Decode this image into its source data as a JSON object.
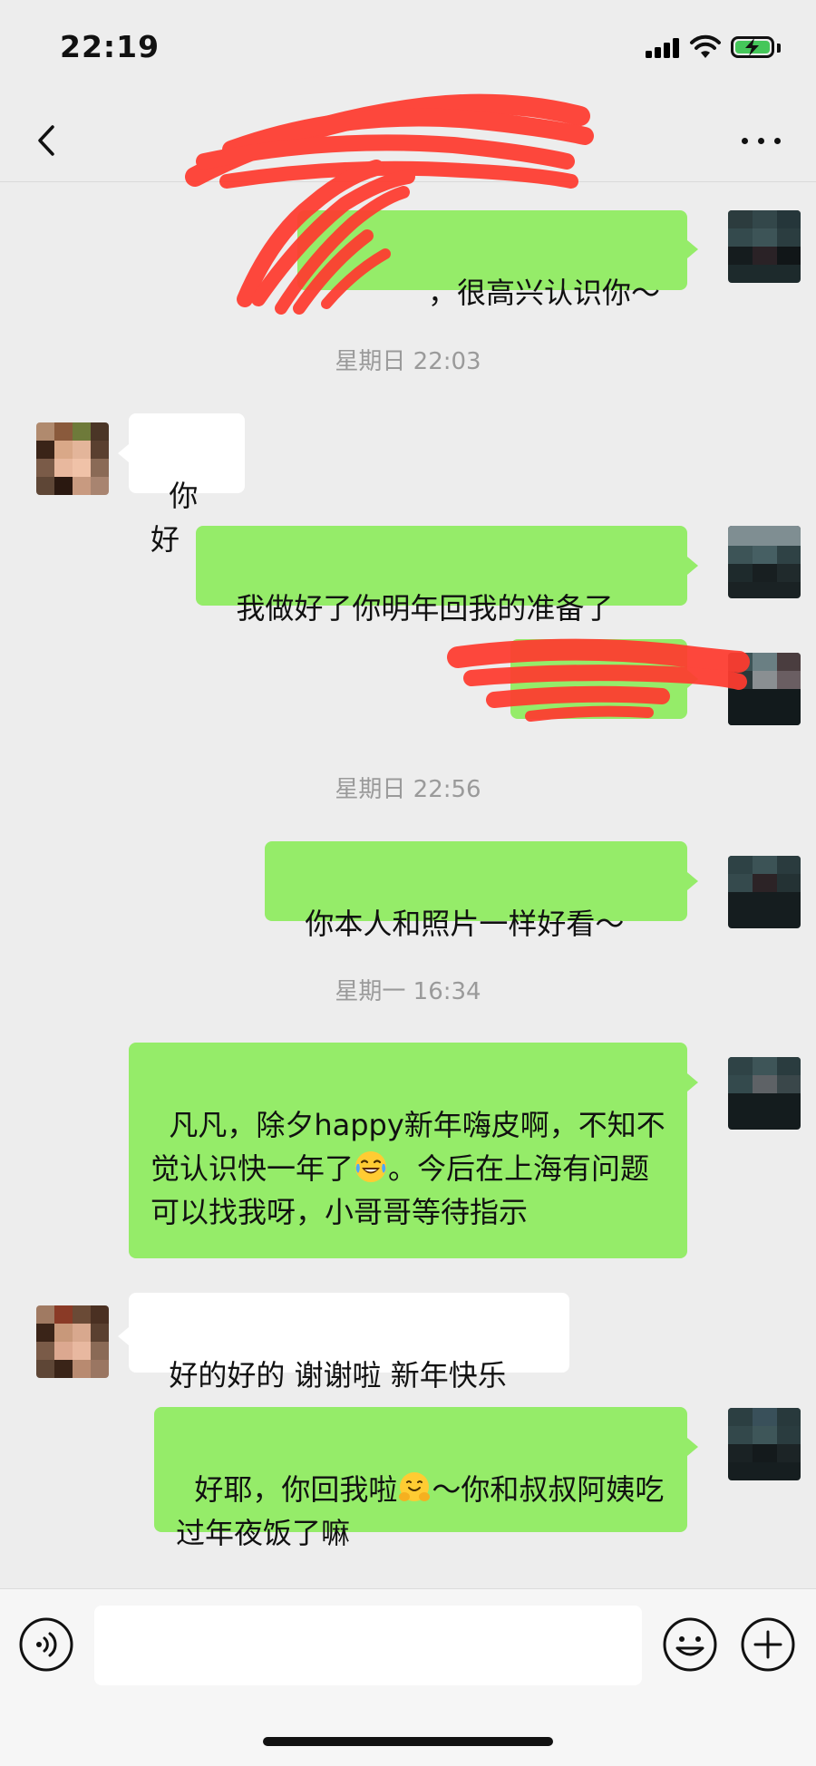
{
  "status_bar": {
    "time": "22:19"
  },
  "nav": {
    "title": ""
  },
  "messages": [
    {
      "side": "out",
      "text": "，很高兴认识你～",
      "partially_redacted": true
    },
    {
      "timestamp": "星期日 22:03"
    },
    {
      "side": "in",
      "text": "你好"
    },
    {
      "side": "out",
      "text": "我做好了你明年回我的准备了"
    },
    {
      "side": "out",
      "text": "",
      "redacted": true
    },
    {
      "timestamp": "星期日 22:56"
    },
    {
      "side": "out",
      "text": "你本人和照片一样好看～"
    },
    {
      "timestamp": "星期一 16:34"
    },
    {
      "side": "out",
      "text_before_emoji": "凡凡，除夕happy新年嗨皮啊，不知不觉认识快一年了",
      "emoji": "face-with-tears-of-joy",
      "text_after_emoji": "。今后在上海有问题可以找我呀，小哥哥等待指示"
    },
    {
      "side": "in",
      "text": "好的好的 谢谢啦 新年快乐"
    },
    {
      "side": "out",
      "text_before_emoji": "好耶，你回我啦",
      "emoji": "hugging-face",
      "text_after_emoji": "～你和叔叔阿姨吃过年夜饭了嘛"
    }
  ],
  "input": {
    "value": "",
    "placeholder": ""
  },
  "icons": {
    "back": "chevron-left-icon",
    "more": "more-horizontal-icon",
    "voice": "voice-icon",
    "emoji": "smiley-icon",
    "plus": "plus-circle-icon"
  },
  "colors": {
    "background": "#ededed",
    "outgoing_bubble": "#95ec69",
    "incoming_bubble": "#ffffff",
    "timestamp_text": "#9a9a9a",
    "redaction": "#ff3b2f",
    "battery": "#45c75a"
  }
}
